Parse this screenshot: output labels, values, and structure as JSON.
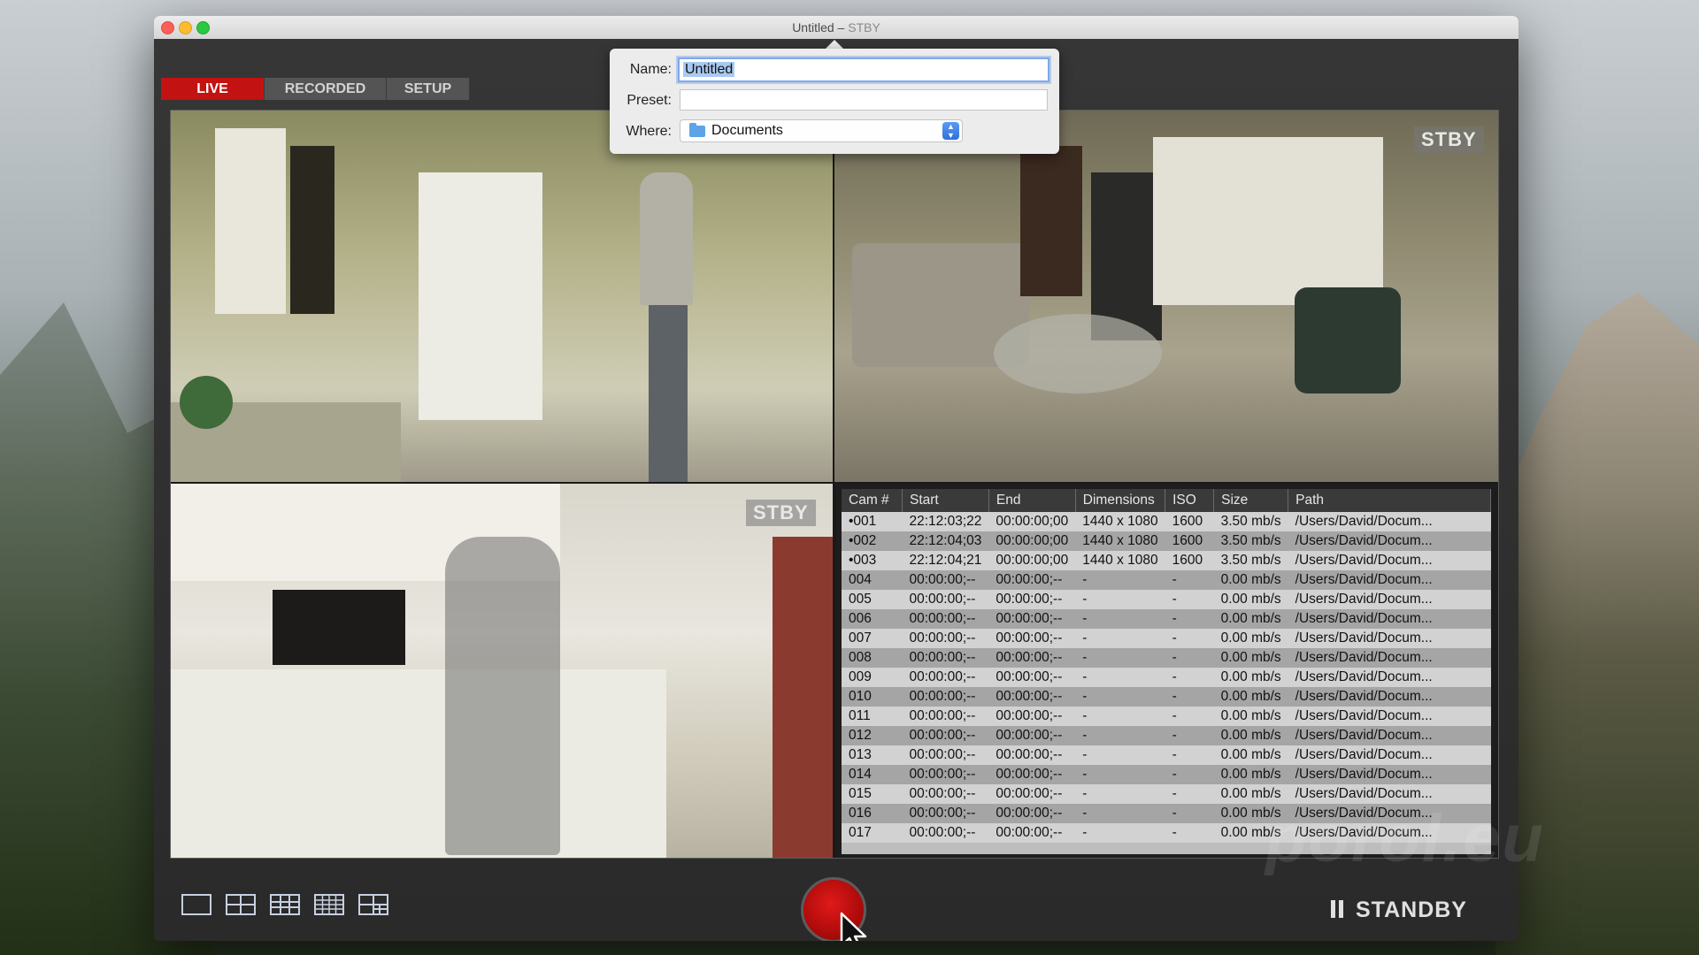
{
  "window": {
    "title": "Untitled",
    "title_sep": " – ",
    "title_status": "STBY"
  },
  "tabs": [
    {
      "label": "LIVE",
      "active": true
    },
    {
      "label": "RECORDED",
      "active": false
    },
    {
      "label": "SETUP",
      "active": false
    }
  ],
  "popover": {
    "name_label": "Name:",
    "name_value": "Untitled",
    "preset_label": "Preset:",
    "preset_value": "",
    "where_label": "Where:",
    "where_value": "Documents",
    "where_icon": "folder-icon"
  },
  "feeds": [
    {
      "id": "cam1",
      "overlay": ""
    },
    {
      "id": "cam2",
      "overlay": "STBY"
    },
    {
      "id": "cam3",
      "overlay": "STBY"
    }
  ],
  "table": {
    "columns": [
      "Cam #",
      "Start",
      "End",
      "Dimensions",
      "ISO",
      "Size",
      "Path"
    ],
    "rows": [
      [
        "•001",
        "22:12:03;22",
        "00:00:00;00",
        "1440 x 1080",
        "1600",
        "3.50 mb/s",
        "/Users/David/Docum..."
      ],
      [
        "•002",
        "22:12:04;03",
        "00:00:00;00",
        "1440 x 1080",
        "1600",
        "3.50 mb/s",
        "/Users/David/Docum..."
      ],
      [
        "•003",
        "22:12:04;21",
        "00:00:00;00",
        "1440 x 1080",
        "1600",
        "3.50 mb/s",
        "/Users/David/Docum..."
      ],
      [
        "004",
        "00:00:00;--",
        "00:00:00;--",
        "-",
        "-",
        "0.00 mb/s",
        "/Users/David/Docum..."
      ],
      [
        "005",
        "00:00:00;--",
        "00:00:00;--",
        "-",
        "-",
        "0.00 mb/s",
        "/Users/David/Docum..."
      ],
      [
        "006",
        "00:00:00;--",
        "00:00:00;--",
        "-",
        "-",
        "0.00 mb/s",
        "/Users/David/Docum..."
      ],
      [
        "007",
        "00:00:00;--",
        "00:00:00;--",
        "-",
        "-",
        "0.00 mb/s",
        "/Users/David/Docum..."
      ],
      [
        "008",
        "00:00:00;--",
        "00:00:00;--",
        "-",
        "-",
        "0.00 mb/s",
        "/Users/David/Docum..."
      ],
      [
        "009",
        "00:00:00;--",
        "00:00:00;--",
        "-",
        "-",
        "0.00 mb/s",
        "/Users/David/Docum..."
      ],
      [
        "010",
        "00:00:00;--",
        "00:00:00;--",
        "-",
        "-",
        "0.00 mb/s",
        "/Users/David/Docum..."
      ],
      [
        "011",
        "00:00:00;--",
        "00:00:00;--",
        "-",
        "-",
        "0.00 mb/s",
        "/Users/David/Docum..."
      ],
      [
        "012",
        "00:00:00;--",
        "00:00:00;--",
        "-",
        "-",
        "0.00 mb/s",
        "/Users/David/Docum..."
      ],
      [
        "013",
        "00:00:00;--",
        "00:00:00;--",
        "-",
        "-",
        "0.00 mb/s",
        "/Users/David/Docum..."
      ],
      [
        "014",
        "00:00:00;--",
        "00:00:00;--",
        "-",
        "-",
        "0.00 mb/s",
        "/Users/David/Docum..."
      ],
      [
        "015",
        "00:00:00;--",
        "00:00:00;--",
        "-",
        "-",
        "0.00 mb/s",
        "/Users/David/Docum..."
      ],
      [
        "016",
        "00:00:00;--",
        "00:00:00;--",
        "-",
        "-",
        "0.00 mb/s",
        "/Users/David/Docum..."
      ],
      [
        "017",
        "00:00:00;--",
        "00:00:00;--",
        "-",
        "-",
        "0.00 mb/s",
        "/Users/David/Docum..."
      ]
    ]
  },
  "bottombar": {
    "layouts": [
      "layout-1x1-icon",
      "layout-2x2-icon",
      "layout-3x3-icon",
      "layout-4x4-icon",
      "layout-custom-icon"
    ],
    "record_icon": "record-icon",
    "status_icon": "pause-icon",
    "status_label": "STANDBY"
  },
  "watermark": "porol.eu",
  "colors": {
    "accent_red": "#c31212",
    "record_red": "#d01414",
    "tab_bg": "#545454"
  }
}
